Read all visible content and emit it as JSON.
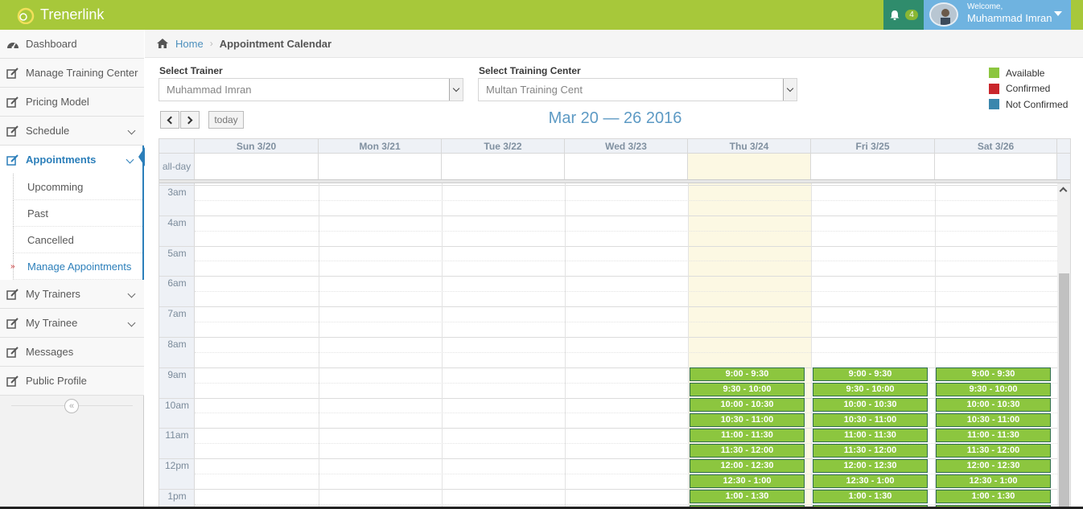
{
  "navbar": {
    "brand": "Trenerlink",
    "notifications": "4",
    "welcome": "Welcome,",
    "user_name": "Muhammad Imran"
  },
  "sidebar": {
    "items": [
      "Dashboard",
      "Manage Training Center",
      "Pricing Model",
      "Schedule",
      "Appointments",
      "My Trainers",
      "My Trainee",
      "Messages",
      "Public Profile"
    ],
    "sub_items": [
      "Upcomming",
      "Past",
      "Cancelled",
      "Manage Appointments"
    ]
  },
  "breadcrumb": {
    "home": "Home",
    "current": "Appointment Calendar"
  },
  "filters": {
    "trainer_label": "Select Trainer",
    "trainer_value": "Muhammad Imran",
    "center_label": "Select Training Center",
    "center_value": "Multan Training Cent"
  },
  "legend": [
    {
      "label": "Available",
      "color": "#8cc63f"
    },
    {
      "label": "Confirmed",
      "color": "#c9262c"
    },
    {
      "label": "Not Confirmed",
      "color": "#3a87ad"
    }
  ],
  "calendar": {
    "today_label": "today",
    "title": "Mar 20 — 26 2016",
    "days": [
      "Sun 3/20",
      "Mon 3/21",
      "Tue 3/22",
      "Wed 3/23",
      "Thu 3/24",
      "Fri 3/25",
      "Sat 3/26"
    ],
    "all_day_label": "all-day",
    "hours": [
      "3am",
      "4am",
      "5am",
      "6am",
      "7am",
      "8am",
      "9am",
      "10am",
      "11am",
      "12pm",
      "1pm"
    ],
    "slots": [
      "9:00 - 9:30",
      "9:30 - 10:00",
      "10:00 - 10:30",
      "10:30 - 11:00",
      "11:00 - 11:30",
      "11:30 - 12:00",
      "12:00 - 12:30",
      "12:30 - 1:00",
      "1:00 - 1:30"
    ]
  }
}
